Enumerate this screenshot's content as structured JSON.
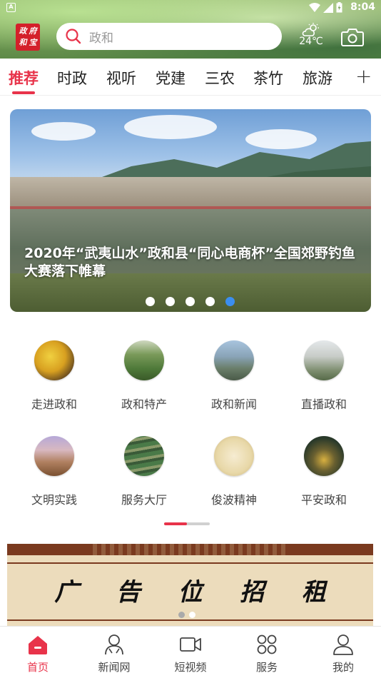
{
  "status_bar": {
    "notification": "A",
    "time": "8:04"
  },
  "header": {
    "logo_chars": [
      "政",
      "府",
      "和",
      "宝"
    ],
    "search_placeholder": "政和",
    "weather_temp": "24℃",
    "icons": [
      "search-icon",
      "weather-cloud-sun-icon",
      "camera-icon"
    ]
  },
  "tabs": {
    "items": [
      "推荐",
      "时政",
      "视听",
      "党建",
      "三农",
      "茶竹",
      "旅游"
    ],
    "active": "推荐",
    "add_label": "+"
  },
  "banner": {
    "caption": "2020年“武夷山水”政和县“同心电商杯”全国郊野钓鱼大赛落下帷幕",
    "dot_count": 5,
    "active_dot": 5
  },
  "grid": {
    "items": [
      {
        "label": "走进政和",
        "icon": "autumn-tree-photo"
      },
      {
        "label": "政和特产",
        "icon": "tea-field-photo"
      },
      {
        "label": "政和新闻",
        "icon": "mountain-town-photo"
      },
      {
        "label": "直播政和",
        "icon": "misty-peaks-photo"
      },
      {
        "label": "文明实践",
        "icon": "rock-pillar-photo"
      },
      {
        "label": "服务大厅",
        "icon": "terraced-fields-photo"
      },
      {
        "label": "俊波精神",
        "icon": "calligraphy-photo"
      },
      {
        "label": "平安政和",
        "icon": "night-city-photo"
      }
    ]
  },
  "ad": {
    "chars": [
      "广",
      "告",
      "位",
      "招",
      "租"
    ]
  },
  "bottom_nav": {
    "items": [
      {
        "label": "首页",
        "icon": "home-icon"
      },
      {
        "label": "新闻网",
        "icon": "news-icon"
      },
      {
        "label": "短视频",
        "icon": "video-icon"
      },
      {
        "label": "服务",
        "icon": "services-grid-icon"
      },
      {
        "label": "我的",
        "icon": "profile-icon"
      }
    ],
    "active": "首页"
  },
  "colors": {
    "accent": "#e8334a",
    "dot_active": "#3b8ef0",
    "logo_red": "#d4202a"
  }
}
